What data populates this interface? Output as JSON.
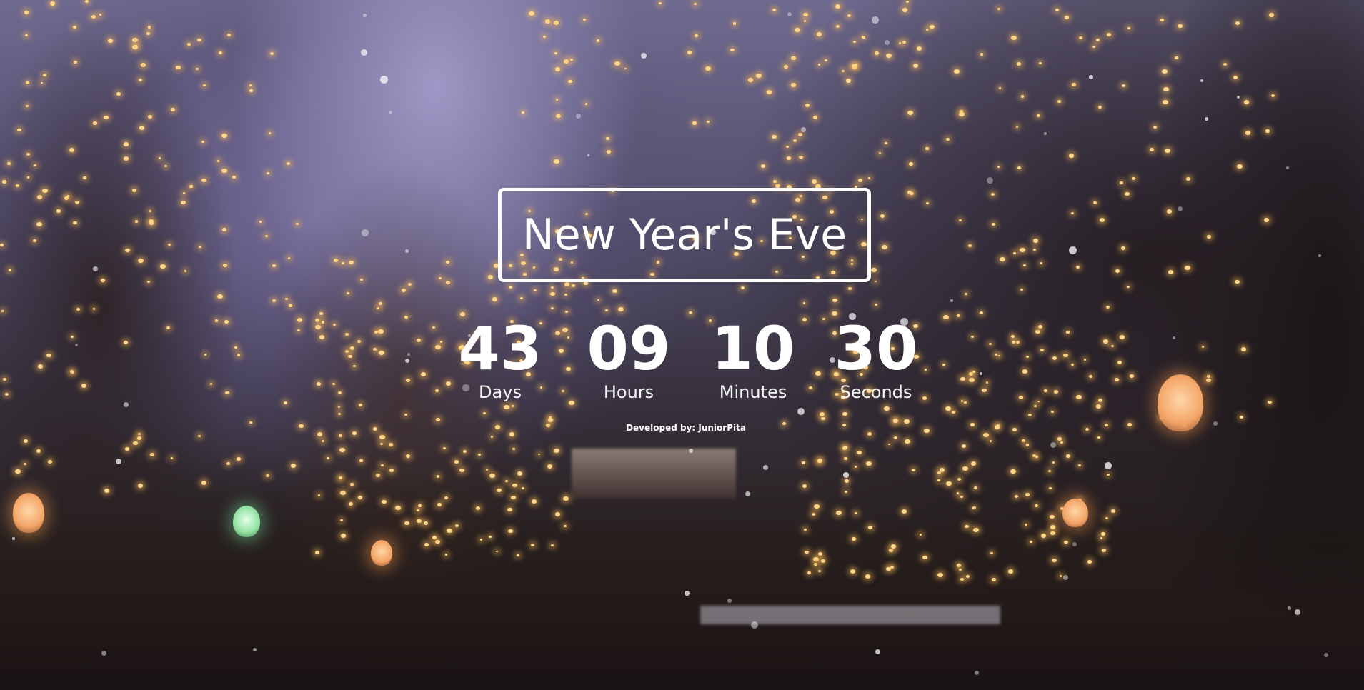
{
  "title": "New Year's Eve",
  "countdown": {
    "days": {
      "value": "43",
      "label": "Days"
    },
    "hours": {
      "value": "09",
      "label": "Hours"
    },
    "minutes": {
      "value": "10",
      "label": "Minutes"
    },
    "seconds": {
      "value": "30",
      "label": "Seconds"
    }
  },
  "credit": "Developed by: JuniorPita",
  "colors": {
    "text": "#ffffff",
    "border": "#ffffff",
    "sky": "#6f6a8f",
    "lights": "#ffd58a"
  }
}
